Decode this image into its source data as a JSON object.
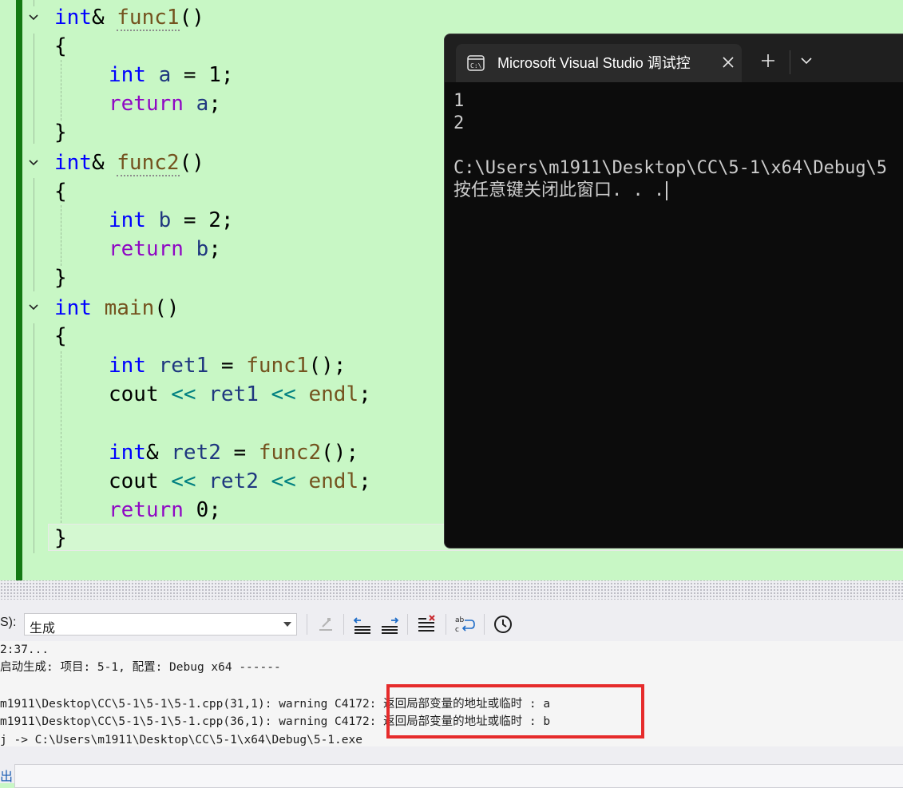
{
  "editor": {
    "lines": [
      {
        "segments": [
          [
            "kw",
            "int"
          ],
          [
            "",
            "& "
          ],
          [
            "fn",
            "func1"
          ],
          [
            "",
            "()"
          ]
        ]
      },
      {
        "segments": [
          [
            "",
            "{"
          ]
        ]
      },
      {
        "segments": [
          [
            "kw",
            "int"
          ],
          [
            "",
            " "
          ],
          [
            "var",
            "a"
          ],
          [
            "",
            " = 1;"
          ]
        ]
      },
      {
        "segments": [
          [
            "ctl",
            "return"
          ],
          [
            "",
            " "
          ],
          [
            "var",
            "a"
          ],
          [
            "",
            ";"
          ]
        ]
      },
      {
        "segments": [
          [
            "",
            "}"
          ]
        ]
      },
      {
        "segments": [
          [
            "kw",
            "int"
          ],
          [
            "",
            "& "
          ],
          [
            "fn",
            "func2"
          ],
          [
            "",
            "()"
          ]
        ]
      },
      {
        "segments": [
          [
            "",
            "{"
          ]
        ]
      },
      {
        "segments": [
          [
            "kw",
            "int"
          ],
          [
            "",
            " "
          ],
          [
            "var",
            "b"
          ],
          [
            "",
            " = 2;"
          ]
        ]
      },
      {
        "segments": [
          [
            "ctl",
            "return"
          ],
          [
            "",
            " "
          ],
          [
            "var",
            "b"
          ],
          [
            "",
            ";"
          ]
        ]
      },
      {
        "segments": [
          [
            "",
            "}"
          ]
        ]
      },
      {
        "segments": [
          [
            "kw",
            "int"
          ],
          [
            "",
            " "
          ],
          [
            "fn",
            "main"
          ],
          [
            "",
            "()"
          ]
        ]
      },
      {
        "segments": [
          [
            "",
            "{"
          ]
        ]
      },
      {
        "segments": [
          [
            "kw",
            "int"
          ],
          [
            "",
            " "
          ],
          [
            "var",
            "ret1"
          ],
          [
            "",
            " = "
          ],
          [
            "fn",
            "func1"
          ],
          [
            "",
            "();"
          ]
        ]
      },
      {
        "segments": [
          [
            "",
            "cout "
          ],
          [
            "op",
            "<<"
          ],
          [
            "",
            " "
          ],
          [
            "var",
            "ret1"
          ],
          [
            "",
            " "
          ],
          [
            "op",
            "<<"
          ],
          [
            "",
            " "
          ],
          [
            "fn",
            "endl"
          ],
          [
            "",
            ";"
          ]
        ]
      },
      {
        "segments": []
      },
      {
        "segments": [
          [
            "kw",
            "int"
          ],
          [
            "",
            "& "
          ],
          [
            "var",
            "ret2"
          ],
          [
            "",
            " = "
          ],
          [
            "fn",
            "func2"
          ],
          [
            "",
            "();"
          ]
        ]
      },
      {
        "segments": [
          [
            "",
            "cout "
          ],
          [
            "op",
            "<<"
          ],
          [
            "",
            " "
          ],
          [
            "var",
            "ret2"
          ],
          [
            "",
            " "
          ],
          [
            "op",
            "<<"
          ],
          [
            "",
            " "
          ],
          [
            "fn",
            "endl"
          ],
          [
            "",
            ";"
          ]
        ]
      },
      {
        "segments": [
          [
            "ctl",
            "return"
          ],
          [
            "",
            " 0;"
          ]
        ]
      },
      {
        "segments": [
          [
            "",
            "}"
          ]
        ]
      }
    ]
  },
  "console": {
    "tab_title": "Microsoft Visual Studio 调试控",
    "tab_icon": "console-icon",
    "close_icon": "close-icon",
    "new_tab_icon": "plus-icon",
    "dropdown_icon": "chevron-down-icon",
    "output": "1\n2\n\nC:\\Users\\m1911\\Desktop\\CC\\5-1\\x64\\Debug\\5\n按任意键关闭此窗口. . ."
  },
  "output_panel": {
    "source_label": "S):",
    "source_value": "生成",
    "lines": [
      "2:37...",
      "启动生成: 项目: 5-1, 配置: Debug x64 ------",
      "",
      "m1911\\Desktop\\CC\\5-1\\5-1\\5-1.cpp(31,1): warning C4172: 返回局部变量的地址或临时 : a",
      "m1911\\Desktop\\CC\\5-1\\5-1\\5-1.cpp(36,1): warning C4172: 返回局部变量的地址或临时 : b",
      "j -> C:\\Users\\m1911\\Desktop\\CC\\5-1\\x64\\Debug\\5-1.exe"
    ],
    "bottom_tab": "出",
    "highlight_color": "#e62b2b"
  }
}
